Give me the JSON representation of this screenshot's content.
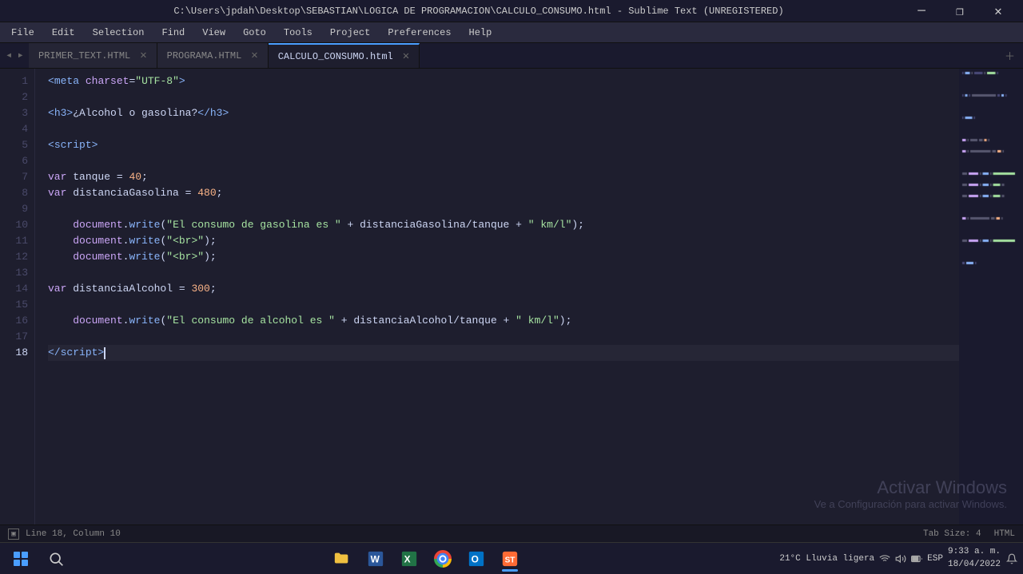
{
  "titlebar": {
    "title": "C:\\Users\\jpdah\\Desktop\\SEBASTIAN\\LOGICA DE PROGRAMACION\\CALCULO_CONSUMO.html - Sublime Text (UNREGISTERED)",
    "minimize": "─",
    "maximize": "□",
    "close": "✕"
  },
  "menubar": {
    "items": [
      "File",
      "Edit",
      "Selection",
      "Find",
      "View",
      "Goto",
      "Tools",
      "Project",
      "Preferences",
      "Help"
    ]
  },
  "tabs": [
    {
      "label": "PRIMER_TEXT.HTML",
      "active": false,
      "closeable": true
    },
    {
      "label": "PROGRAMA.HTML",
      "active": false,
      "closeable": true
    },
    {
      "label": "CALCULO_CONSUMO.html",
      "active": true,
      "closeable": true
    }
  ],
  "editor": {
    "lines": [
      {
        "num": 1,
        "active": false,
        "tokens": [
          {
            "t": "tagbracket",
            "v": "<"
          },
          {
            "t": "tag",
            "v": "meta"
          },
          {
            "t": "plain",
            "v": " "
          },
          {
            "t": "attr",
            "v": "charset"
          },
          {
            "t": "plain",
            "v": "="
          },
          {
            "t": "string",
            "v": "\"UTF-8\""
          },
          {
            "t": "tagbracket",
            "v": ">"
          }
        ]
      },
      {
        "num": 2,
        "active": false,
        "tokens": []
      },
      {
        "num": 3,
        "active": false,
        "tokens": [
          {
            "t": "tagbracket",
            "v": "<"
          },
          {
            "t": "tag",
            "v": "h3"
          },
          {
            "t": "tagbracket",
            "v": ">"
          },
          {
            "t": "plain",
            "v": "¿Alcohol o gasolina?"
          },
          {
            "t": "tagbracket",
            "v": "</"
          },
          {
            "t": "tag",
            "v": "h3"
          },
          {
            "t": "tagbracket",
            "v": ">"
          }
        ]
      },
      {
        "num": 4,
        "active": false,
        "tokens": []
      },
      {
        "num": 5,
        "active": false,
        "tokens": [
          {
            "t": "tagbracket",
            "v": "<"
          },
          {
            "t": "tag",
            "v": "script"
          },
          {
            "t": "tagbracket",
            "v": ">"
          }
        ]
      },
      {
        "num": 6,
        "active": false,
        "tokens": []
      },
      {
        "num": 7,
        "active": false,
        "tokens": [
          {
            "t": "kw",
            "v": "var"
          },
          {
            "t": "plain",
            "v": " "
          },
          {
            "t": "varname",
            "v": "tanque"
          },
          {
            "t": "plain",
            "v": " = "
          },
          {
            "t": "num",
            "v": "40"
          },
          {
            "t": "plain",
            "v": ";"
          }
        ]
      },
      {
        "num": 8,
        "active": false,
        "tokens": [
          {
            "t": "kw",
            "v": "var"
          },
          {
            "t": "plain",
            "v": " "
          },
          {
            "t": "varname",
            "v": "distanciaGasolina"
          },
          {
            "t": "plain",
            "v": " = "
          },
          {
            "t": "num",
            "v": "480"
          },
          {
            "t": "plain",
            "v": ";"
          }
        ]
      },
      {
        "num": 9,
        "active": false,
        "tokens": []
      },
      {
        "num": 10,
        "active": false,
        "tokens": [
          {
            "t": "plain",
            "v": "    "
          },
          {
            "t": "obj",
            "v": "document"
          },
          {
            "t": "plain",
            "v": "."
          },
          {
            "t": "method",
            "v": "write"
          },
          {
            "t": "plain",
            "v": "("
          },
          {
            "t": "string",
            "v": "\"El consumo de gasolina es \""
          },
          {
            "t": "plain",
            "v": " + distanciaGasolina/tanque + "
          },
          {
            "t": "string",
            "v": "\" km/l\""
          },
          {
            "t": "plain",
            "v": ");"
          }
        ]
      },
      {
        "num": 11,
        "active": false,
        "tokens": [
          {
            "t": "plain",
            "v": "    "
          },
          {
            "t": "obj",
            "v": "document"
          },
          {
            "t": "plain",
            "v": "."
          },
          {
            "t": "method",
            "v": "write"
          },
          {
            "t": "plain",
            "v": "("
          },
          {
            "t": "string",
            "v": "\"<br>\""
          },
          {
            "t": "plain",
            "v": ");"
          }
        ]
      },
      {
        "num": 12,
        "active": false,
        "tokens": [
          {
            "t": "plain",
            "v": "    "
          },
          {
            "t": "obj",
            "v": "document"
          },
          {
            "t": "plain",
            "v": "."
          },
          {
            "t": "method",
            "v": "write"
          },
          {
            "t": "plain",
            "v": "("
          },
          {
            "t": "string",
            "v": "\"<br>\""
          },
          {
            "t": "plain",
            "v": ");"
          }
        ]
      },
      {
        "num": 13,
        "active": false,
        "tokens": []
      },
      {
        "num": 14,
        "active": false,
        "tokens": [
          {
            "t": "kw",
            "v": "var"
          },
          {
            "t": "plain",
            "v": " "
          },
          {
            "t": "varname",
            "v": "distanciaAlcohol"
          },
          {
            "t": "plain",
            "v": " = "
          },
          {
            "t": "num",
            "v": "300"
          },
          {
            "t": "plain",
            "v": ";"
          }
        ]
      },
      {
        "num": 15,
        "active": false,
        "tokens": []
      },
      {
        "num": 16,
        "active": false,
        "tokens": [
          {
            "t": "plain",
            "v": "    "
          },
          {
            "t": "obj",
            "v": "document"
          },
          {
            "t": "plain",
            "v": "."
          },
          {
            "t": "method",
            "v": "write"
          },
          {
            "t": "plain",
            "v": "("
          },
          {
            "t": "string",
            "v": "\"El consumo de alcohol es \""
          },
          {
            "t": "plain",
            "v": " + distanciaAlcohol/tanque + "
          },
          {
            "t": "string",
            "v": "\" km/l\""
          },
          {
            "t": "plain",
            "v": ");"
          }
        ]
      },
      {
        "num": 17,
        "active": false,
        "tokens": []
      },
      {
        "num": 18,
        "active": true,
        "tokens": [
          {
            "t": "tagbracket",
            "v": "</"
          },
          {
            "t": "tag",
            "v": "script"
          },
          {
            "t": "tagbracket",
            "v": ">"
          },
          {
            "t": "cursor",
            "v": ""
          }
        ]
      }
    ]
  },
  "statusbar": {
    "left": {
      "icon": "▣",
      "position": "Line 18, Column 10"
    },
    "right": {
      "tab_size": "Tab Size: 4",
      "language": "HTML"
    }
  },
  "watermark": {
    "title": "Activar Windows",
    "subtitle": "Ve a Configuración para activar Windows."
  },
  "taskbar": {
    "time": "9:33 a. m.",
    "date": "18/04/2022",
    "language": "ESP",
    "weather": "21°C  Lluvia ligera",
    "apps": [
      {
        "name": "start",
        "label": "Start"
      },
      {
        "name": "search",
        "label": "Search"
      },
      {
        "name": "explorer",
        "label": "File Explorer"
      },
      {
        "name": "word",
        "label": "Word"
      },
      {
        "name": "excel",
        "label": "Excel"
      },
      {
        "name": "chrome",
        "label": "Chrome"
      },
      {
        "name": "outlook",
        "label": "Outlook"
      },
      {
        "name": "sublime",
        "label": "Sublime Text",
        "active": true
      }
    ]
  }
}
